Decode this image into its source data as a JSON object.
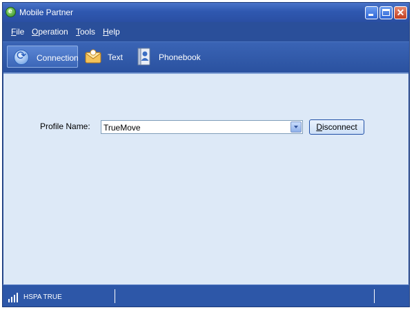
{
  "window": {
    "title": "Mobile Partner"
  },
  "menu": [
    {
      "mnemonic": "F",
      "rest": "ile"
    },
    {
      "mnemonic": "O",
      "rest": "peration"
    },
    {
      "mnemonic": "T",
      "rest": "ools"
    },
    {
      "mnemonic": "H",
      "rest": "elp"
    }
  ],
  "toolbar": {
    "connection": "Connection",
    "text": "Text",
    "phonebook": "Phonebook"
  },
  "connection": {
    "profile_label": "Profile Name:",
    "profile_value": "TrueMove",
    "disconnect_mnemonic": "D",
    "disconnect_rest": "isconnect"
  },
  "status": {
    "network": "HSPA TRUE"
  },
  "colors": {
    "frame": "#2a4f9a",
    "content": "#dde9f7"
  }
}
